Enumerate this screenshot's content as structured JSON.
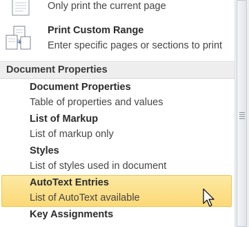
{
  "menu": {
    "print_current_desc": "Only print the current page",
    "custom_range": {
      "title": "Print Custom Range",
      "desc": "Enter specific pages or sections to print"
    },
    "section_header": "Document Properties",
    "items": [
      {
        "title": "Document Properties",
        "desc": "Table of properties and values"
      },
      {
        "title": "List of Markup",
        "desc": "List of markup only"
      },
      {
        "title": "Styles",
        "desc": "List of styles used in document"
      },
      {
        "title": "AutoText Entries",
        "desc": "List of AutoText available"
      },
      {
        "title": "Key Assignments",
        "desc": ""
      }
    ]
  },
  "icons": {
    "current_page": "page-icon",
    "custom_range": "custom-range-icon",
    "cursor": "mouse-pointer-icon",
    "scroll_grip": "scroll-grip-icon"
  },
  "colors": {
    "highlight": "#fbd977",
    "highlight_border": "#f2c350",
    "section_header_bg": "#eeeeef"
  },
  "state": {
    "highlighted_item": "AutoText Entries"
  }
}
